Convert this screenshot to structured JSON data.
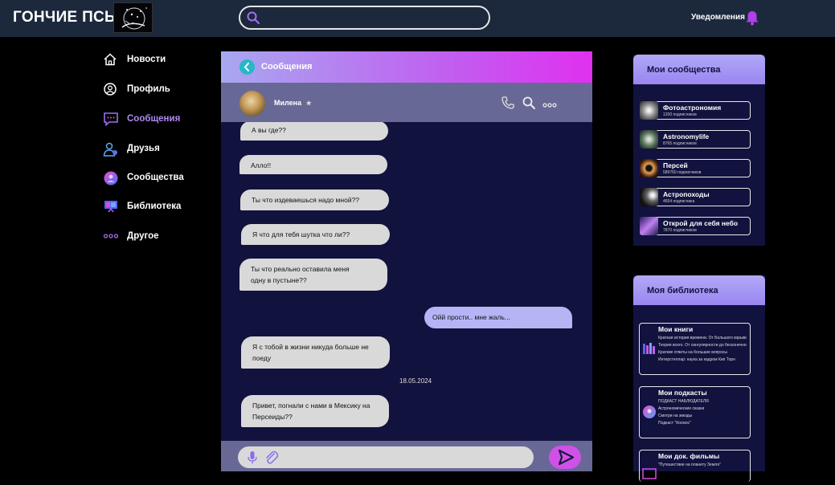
{
  "header": {
    "logo_text": "ГОНЧИЕ ПСЫ",
    "search_placeholder": "",
    "notifications_label": "Уведомления"
  },
  "nav": {
    "items": [
      {
        "label": "Новости",
        "icon": "home-icon"
      },
      {
        "label": "Профиль",
        "icon": "profile-icon"
      },
      {
        "label": "Сообщения",
        "icon": "messages-icon",
        "active": true
      },
      {
        "label": "Друзья",
        "icon": "friends-icon"
      },
      {
        "label": "Сообщества",
        "icon": "communities-icon"
      },
      {
        "label": "Библиотека",
        "icon": "library-icon"
      },
      {
        "label": "Другое",
        "icon": "more-icon"
      }
    ]
  },
  "chat": {
    "title": "Сообщения",
    "contact_name": "Милена",
    "messages": [
      {
        "text": "А вы где??",
        "dir": "in"
      },
      {
        "text": "Алло!!",
        "dir": "in"
      },
      {
        "text": "Ты что издеваешься надо мной??",
        "dir": "in"
      },
      {
        "text": "Я что для тебя шутка что ли??",
        "dir": "in"
      },
      {
        "text": "Ты что реально оставила меня одну в пустыне??",
        "dir": "in"
      },
      {
        "text": "Ойй прости.. мне жаль...",
        "dir": "out"
      },
      {
        "text": "Я с тобой в жизни никуда больше не поеду",
        "dir": "in"
      },
      {
        "text": "Привет, погнали с нами в Мексику на Персеиды??",
        "dir": "in"
      }
    ],
    "date_separator": "18.05.2024",
    "input_placeholder": ""
  },
  "communities": {
    "title": "Мои сообщества",
    "items": [
      {
        "name": "Фотоастрономия",
        "subs": "1200 подписчиков"
      },
      {
        "name": "Astronomylife",
        "subs": "8765 подписчиков"
      },
      {
        "name": "Персей",
        "subs": "589760 подписчиков"
      },
      {
        "name": "Астропоходы",
        "subs": "4654 подписчика"
      },
      {
        "name": "Открой для себя небо",
        "subs": "7870 подписчиков"
      }
    ]
  },
  "library": {
    "title": "Моя библиотека",
    "sections": [
      {
        "title": "Мои книги",
        "items": [
          "Краткая история времени. От Большого взрыва до черных дыр",
          "Теория всего. От сингулярности до бесконечности",
          "Краткие ответы на большие вопросы",
          "Интерстеллар: наука за кадром Кип Торн"
        ]
      },
      {
        "title": "Мои подкасты",
        "items": [
          "ПОДКАСТ НАБЛЮДАТЕЛЯ",
          "Астрономические сказки",
          "Смотри на звезды",
          "Подкаст \"Космос\""
        ]
      },
      {
        "title": "Мои док. фильмы",
        "items": [
          "\"Путешествие на планету Земля\""
        ]
      }
    ]
  },
  "colors": {
    "header_bg": "#1c283c",
    "chat_bg": "#12123f",
    "accent": "#b08af0"
  }
}
